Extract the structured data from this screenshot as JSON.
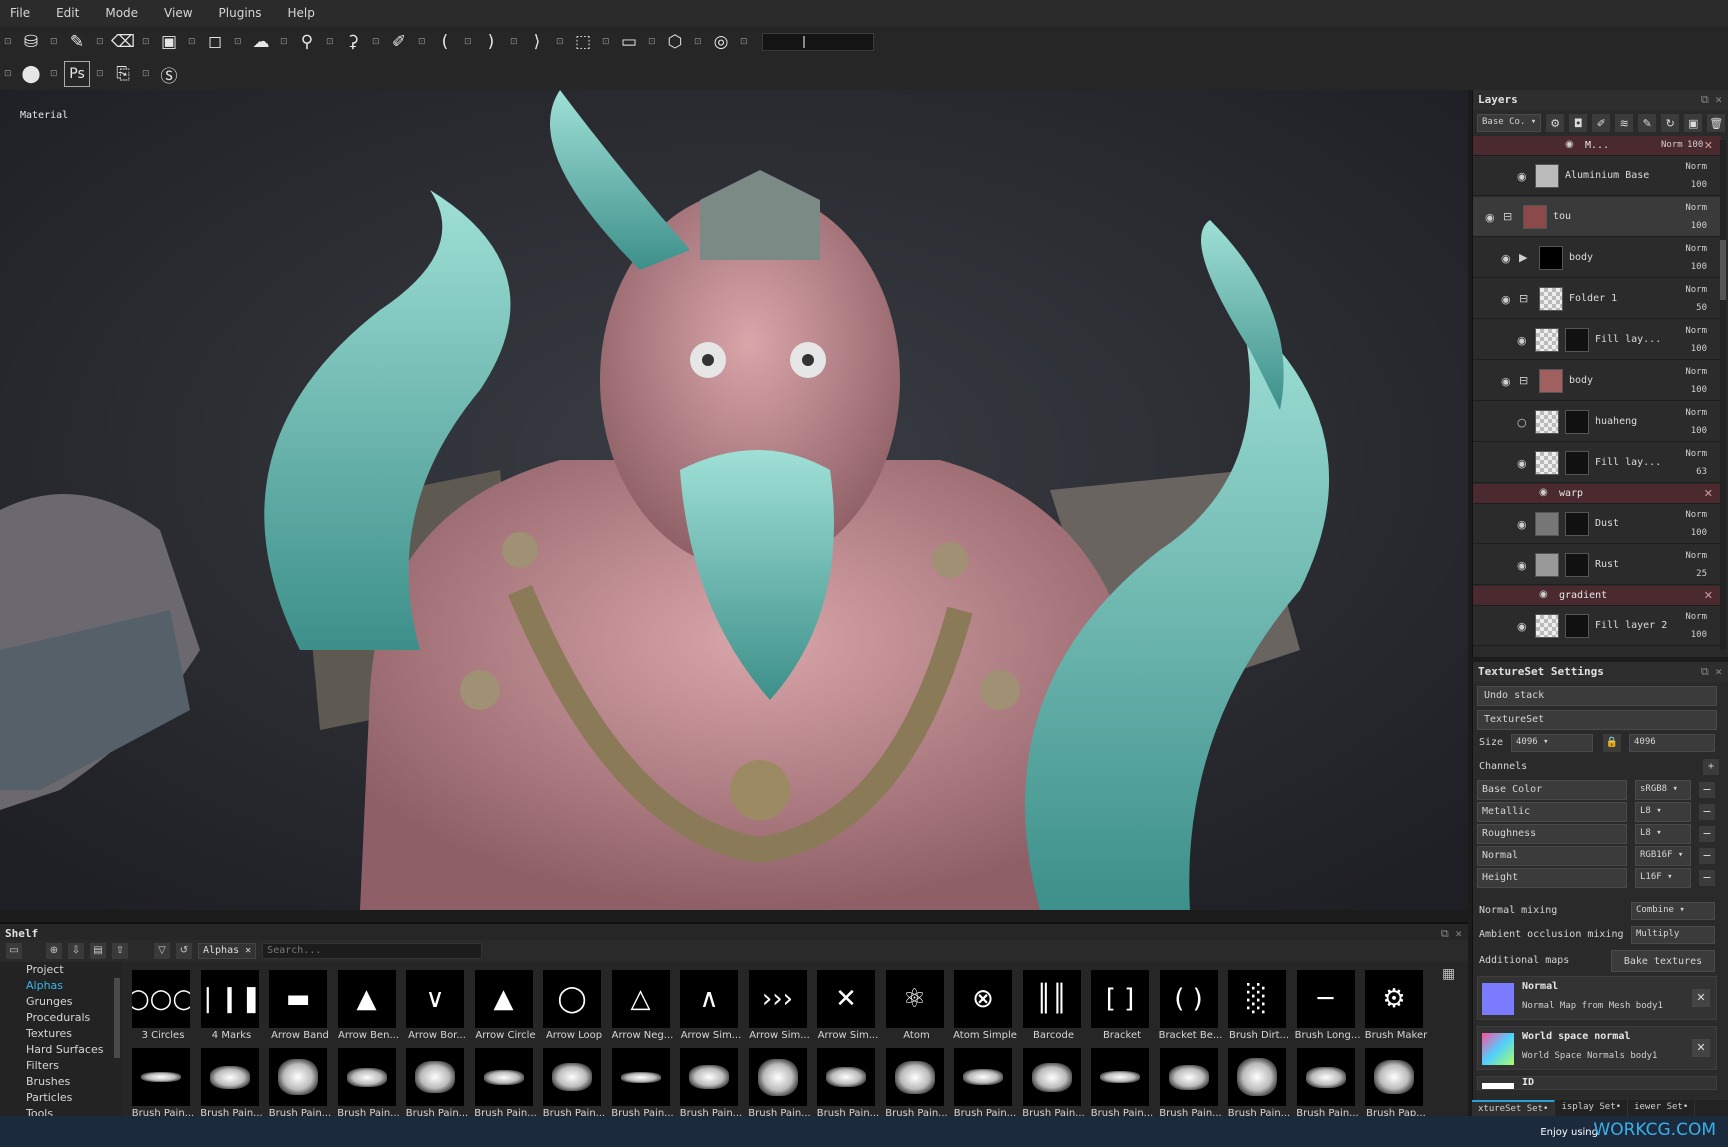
{
  "menu": [
    "File",
    "Edit",
    "Mode",
    "View",
    "Plugins",
    "Help"
  ],
  "toolbar": {
    "row1_icons": [
      "logo-icon",
      "paint-icon",
      "eraser-icon",
      "projection-icon",
      "polyfill-icon",
      "smudge-icon",
      "clone-icon",
      "clone-stamp-icon",
      "color-picker-icon",
      "symmetry-icon",
      "symmetry-x-icon",
      "symmetry-mirror-icon",
      "camera-icon",
      "screen-icon",
      "cube-icon",
      "render-icon",
      "slider-icon"
    ],
    "row2_icons": [
      "iray-icon",
      "photoshop-icon",
      "export-icon",
      "substance-icon"
    ],
    "ps_label": "Ps"
  },
  "viewport": {
    "label": "Material"
  },
  "layers": {
    "title": "Layers",
    "channel_dropdown": "Base Co.",
    "rows": [
      {
        "type": "filter",
        "name": "M...",
        "blend": "Norm",
        "opacity": "100"
      },
      {
        "type": "layer",
        "name": "Aluminium Base",
        "blend": "Norm",
        "opacity": "100"
      },
      {
        "type": "layer",
        "name": "tou",
        "blend": "Norm",
        "opacity": "100"
      },
      {
        "type": "layer",
        "name": "body",
        "blend": "Norm",
        "opacity": "100"
      },
      {
        "type": "layer",
        "name": "Folder 1",
        "blend": "Norm",
        "opacity": "50"
      },
      {
        "type": "layer",
        "name": "Fill lay...",
        "blend": "Norm",
        "opacity": "100"
      },
      {
        "type": "layer",
        "name": "body",
        "blend": "Norm",
        "opacity": "100"
      },
      {
        "type": "layer",
        "name": "huaheng",
        "blend": "Norm",
        "opacity": "100"
      },
      {
        "type": "layer",
        "name": "Fill lay...",
        "blend": "Norm",
        "opacity": "63"
      },
      {
        "type": "filter",
        "name": "warp"
      },
      {
        "type": "layer",
        "name": "Dust",
        "blend": "Norm",
        "opacity": "100"
      },
      {
        "type": "layer",
        "name": "Rust",
        "blend": "Norm",
        "opacity": "25"
      },
      {
        "type": "filter",
        "name": "gradient"
      },
      {
        "type": "layer",
        "name": "Fill layer 2",
        "blend": "Norm",
        "opacity": "100"
      }
    ]
  },
  "textureset": {
    "title": "TextureSet Settings",
    "undo_stack": "Undo stack",
    "textureset_label": "TextureSet",
    "size_label": "Size",
    "size_value": "4096",
    "size_value2": "4096",
    "channels_label": "Channels",
    "channels": [
      {
        "name": "Base Color",
        "format": "sRGB8"
      },
      {
        "name": "Metallic",
        "format": "L8"
      },
      {
        "name": "Roughness",
        "format": "L8"
      },
      {
        "name": "Normal",
        "format": "RGB16F"
      },
      {
        "name": "Height",
        "format": "L16F"
      }
    ],
    "normal_mixing_label": "Normal mixing",
    "normal_mixing_value": "Combine",
    "ao_mixing_label": "Ambient occlusion mixing",
    "ao_mixing_value": "Multiply",
    "additional_maps_label": "Additional maps",
    "bake_button": "Bake textures",
    "maps": [
      {
        "title": "Normal",
        "desc": "Normal Map from Mesh body1",
        "color": "#7b7bff"
      },
      {
        "title": "World space normal",
        "desc": "World Space Normals body1",
        "color": "#55c4a8"
      },
      {
        "title": "ID",
        "desc": "",
        "color": "#ffffff"
      }
    ],
    "tabs": [
      "xtureSet Set•",
      "isplay Set•",
      "iewer Set•"
    ]
  },
  "shelf": {
    "title": "Shelf",
    "tab": "Alphas",
    "search_placeholder": "Search...",
    "categories": [
      "Project",
      "Alphas",
      "Grunges",
      "Procedurals",
      "Textures",
      "Hard Surfaces",
      "Filters",
      "Brushes",
      "Particles",
      "Tools"
    ],
    "active_category": "Alphas",
    "row1": [
      "3 Circles",
      "4 Marks",
      "Arrow Band",
      "Arrow Ben...",
      "Arrow Bor...",
      "Arrow Circle",
      "Arrow Loop",
      "Arrow Neg...",
      "Arrow Sim...",
      "Arrow Sim...",
      "Arrow Sim...",
      "Atom",
      "Atom Simple",
      "Barcode",
      "Bracket",
      "Bracket Be...",
      "Brush Dirt...",
      "Brush Long...",
      "Brush Maker"
    ],
    "row1_glyphs": [
      "○○○",
      "❘❙❚",
      "▬",
      "▲",
      "∨",
      "▲",
      "◯",
      "△",
      "∧",
      "›››",
      "✕",
      "⚛",
      "⊗",
      "║║",
      "[ ]",
      "( )",
      "░",
      "─",
      "⚙"
    ],
    "row2": [
      "Brush Pain...",
      "Brush Pain...",
      "Brush Pain...",
      "Brush Pain...",
      "Brush Pain...",
      "Brush Pain...",
      "Brush Pain...",
      "Brush Pain...",
      "Brush Pain...",
      "Brush Pain...",
      "Brush Pain...",
      "Brush Pain...",
      "Brush Pain...",
      "Brush Pain...",
      "Brush Pain...",
      "Brush Pain...",
      "Brush Pain...",
      "Brush Pain...",
      "Brush Pap..."
    ]
  },
  "status": {
    "enjoy": "Enjoy using",
    "brand": "WORKCG.COM"
  },
  "colors": {
    "accent": "#3ab5ea",
    "filter_row": "#4a2a2e",
    "panel": "#2a2a2a"
  }
}
